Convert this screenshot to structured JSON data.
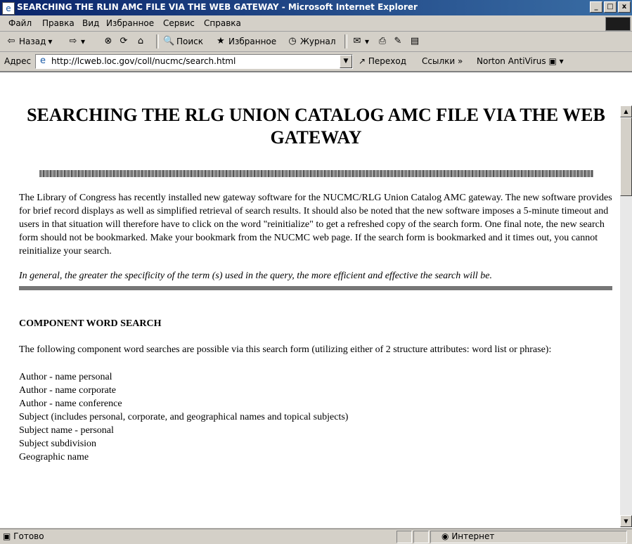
{
  "window": {
    "title": "SEARCHING THE RLIN AMC FILE VIA THE WEB GATEWAY - Microsoft Internet Explorer",
    "min_label": "_",
    "max_label": "□",
    "close_label": "x"
  },
  "menu": {
    "items": [
      "Файл",
      "Правка",
      "Вид",
      "Избранное",
      "Сервис",
      "Справка"
    ]
  },
  "toolbar": {
    "back_label": "Назад",
    "search_label": "Поиск",
    "favorites_label": "Избранное",
    "history_label": "Журнал"
  },
  "address": {
    "label": "Адрес",
    "url": "http://lcweb.loc.gov/coll/nucmc/search.html",
    "go_label": "Переход",
    "links_label": "Ссылки",
    "norton_label": "Norton AntiVirus"
  },
  "page": {
    "title": "SEARCHING THE RLG UNION CATALOG AMC FILE VIA THE WEB GATEWAY",
    "intro": "The Library of Congress has recently installed new gateway software for the NUCMC/RLG Union Catalog AMC gateway. The new software provides for brief record displays as well as simplified retrieval of search results. It should also be noted that the new software imposes a 5-minute timeout and users in that situation will therefore have to click on the word \"reinitialize\" to get a refreshed copy of the search form. One final note, the new search form should not be bookmarked. Make your bookmark from the NUCMC web page. If the search form is bookmarked and it times out, you cannot reinitialize your search.",
    "note": "In general, the greater the specificity of the term (s) used in the query, the more efficient and effective the search will be.",
    "heading": "COMPONENT WORD SEARCH",
    "paragraph": "The following component word searches are possible via this search form (utilizing either of 2 structure attributes: word list or phrase):",
    "list": [
      "Author - name personal",
      "Author - name corporate",
      "Author - name conference",
      "Subject (includes personal, corporate, and geographical names and topical subjects)",
      "Subject name - personal",
      "Subject subdivision",
      "Geographic name"
    ]
  },
  "status": {
    "text": "Готово",
    "zone": "Интернет"
  }
}
